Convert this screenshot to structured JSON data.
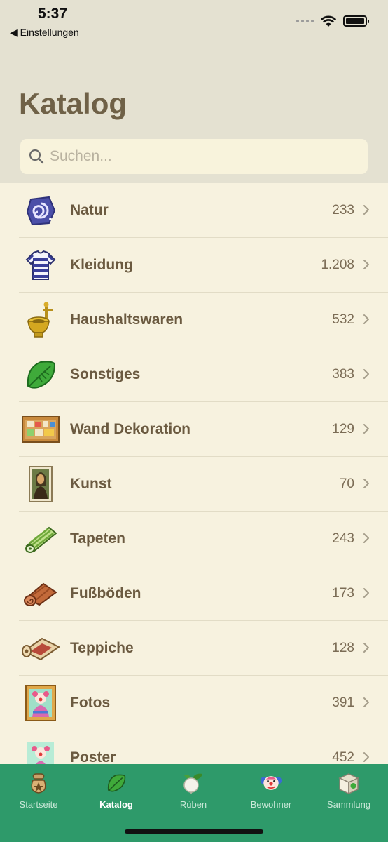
{
  "status": {
    "time": "5:37",
    "back_label": "◀ Einstellungen"
  },
  "page": {
    "title": "Katalog"
  },
  "search": {
    "placeholder": "Suchen..."
  },
  "categories": [
    {
      "label": "Natur",
      "count": "233",
      "icon": "fossil-icon"
    },
    {
      "label": "Kleidung",
      "count": "1.208",
      "icon": "striped-shirt-icon"
    },
    {
      "label": "Haushaltswaren",
      "count": "532",
      "icon": "golden-toilet-icon"
    },
    {
      "label": "Sonstiges",
      "count": "383",
      "icon": "leaf-icon"
    },
    {
      "label": "Wand Dekoration",
      "count": "129",
      "icon": "bulletin-board-icon"
    },
    {
      "label": "Kunst",
      "count": "70",
      "icon": "painting-icon"
    },
    {
      "label": "Tapeten",
      "count": "243",
      "icon": "wallpaper-roll-icon"
    },
    {
      "label": "Fußböden",
      "count": "173",
      "icon": "flooring-roll-icon"
    },
    {
      "label": "Teppiche",
      "count": "128",
      "icon": "rug-icon"
    },
    {
      "label": "Fotos",
      "count": "391",
      "icon": "photo-frame-icon"
    },
    {
      "label": "Poster",
      "count": "452",
      "icon": "poster-icon"
    }
  ],
  "tabbar": {
    "tabs": [
      {
        "label": "Startseite",
        "icon": "bell-bag-icon",
        "active": false
      },
      {
        "label": "Katalog",
        "icon": "leaf-icon",
        "active": true
      },
      {
        "label": "Rüben",
        "icon": "turnip-icon",
        "active": false
      },
      {
        "label": "Bewohner",
        "icon": "villager-icon",
        "active": false
      },
      {
        "label": "Sammlung",
        "icon": "box-icon",
        "active": false
      }
    ]
  },
  "colors": {
    "header_bg": "#e4e1d1",
    "list_bg": "#f7f2df",
    "tabbar_bg": "#2e9a6a",
    "text": "#6b5a40"
  }
}
